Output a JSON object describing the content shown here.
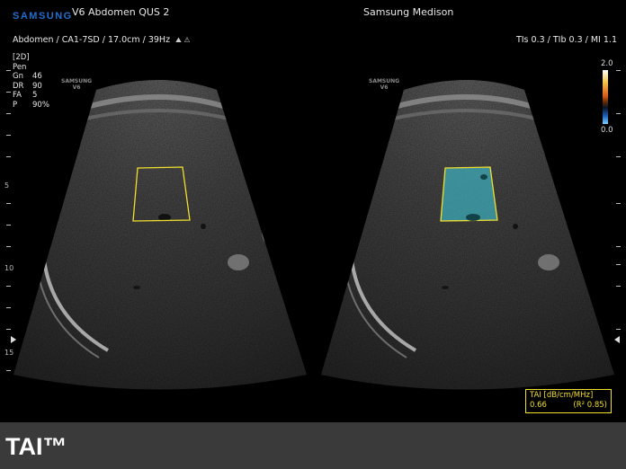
{
  "header": {
    "brand": "SAMSUNG",
    "title": "V6 Abdomen QUS 2",
    "manufacturer": "Samsung Medison",
    "preset": "Abdomen / CA1-7SD / 17.0cm / 39Hz",
    "indices": "TIs  0.3 / TIb  0.3 / MI    1.1"
  },
  "params": [
    {
      "label": "[2D]",
      "value": ""
    },
    {
      "label": "Pen",
      "value": ""
    },
    {
      "label": "Gn",
      "value": "46"
    },
    {
      "label": "DR",
      "value": "90"
    },
    {
      "label": "FA",
      "value": "5"
    },
    {
      "label": "P",
      "value": "90%"
    }
  ],
  "watermark": {
    "line1": "SAMSUNG",
    "line2": "V6"
  },
  "depth_scale": {
    "labels": [
      "5",
      "10",
      "15"
    ]
  },
  "colorbar": {
    "max": "2.0",
    "min": "0.0"
  },
  "tai_result": {
    "label": "TAI [dB/cm/MHz]",
    "value": "0.66",
    "r2": "(R² 0.85)"
  },
  "colors": {
    "roi": "#f2df2e",
    "tai_overlay": "#3ec4d4",
    "brand": "#1e6fd0"
  },
  "footer": {
    "label": "TAI™"
  }
}
